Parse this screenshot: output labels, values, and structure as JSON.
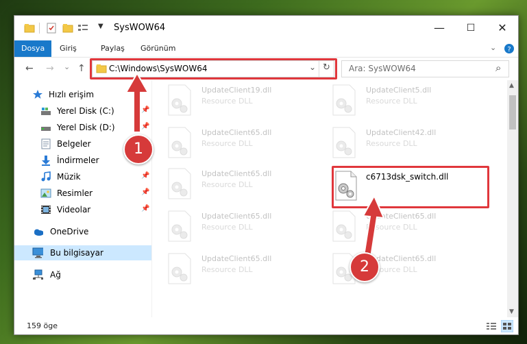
{
  "window": {
    "title": "SysWOW64",
    "controls": {
      "minimize": "—",
      "maximize": "☐",
      "close": "✕"
    }
  },
  "ribbon": {
    "tabs": [
      {
        "label": "Dosya",
        "active": true
      },
      {
        "label": "Giriş",
        "active": false
      },
      {
        "label": "Paylaş",
        "active": false
      },
      {
        "label": "Görünüm",
        "active": false
      }
    ],
    "expand_icon": "chevron-down-icon",
    "help_icon": "help-icon"
  },
  "navigation": {
    "back": "←",
    "forward": "→",
    "recent": "⌄",
    "up": "↑",
    "address": "C:\\Windows\\SysWOW64",
    "address_dropdown": "⌄",
    "refresh": "↻",
    "search_placeholder": "Ara: SysWOW64",
    "search_icon": "⌕"
  },
  "sidebar": {
    "items": [
      {
        "label": "Hızlı erişim",
        "icon": "star-icon",
        "pinned": false
      },
      {
        "label": "Yerel Disk (C:)",
        "icon": "drive-icon",
        "pinned": true
      },
      {
        "label": "Yerel Disk (D:)",
        "icon": "drive-icon",
        "pinned": true
      },
      {
        "label": "Belgeler",
        "icon": "document-icon",
        "pinned": true
      },
      {
        "label": "İndirmeler",
        "icon": "download-icon",
        "pinned": true
      },
      {
        "label": "Müzik",
        "icon": "music-icon",
        "pinned": true
      },
      {
        "label": "Resimler",
        "icon": "pictures-icon",
        "pinned": true
      },
      {
        "label": "Videolar",
        "icon": "video-icon",
        "pinned": true
      },
      {
        "label": "OneDrive",
        "icon": "cloud-icon",
        "pinned": false
      },
      {
        "label": "Bu bilgisayar",
        "icon": "computer-icon",
        "pinned": false,
        "selected": true
      },
      {
        "label": "Ağ",
        "icon": "network-icon",
        "pinned": false
      }
    ],
    "pin_glyph": "📌"
  },
  "files": [
    {
      "name": "UpdateClient19.dll",
      "desc": "Resource DLL"
    },
    {
      "name": "UpdateClient5.dll",
      "desc": "Resource DLL"
    },
    {
      "name": "UpdateClient65.dll",
      "desc": "Resource DLL"
    },
    {
      "name": "UpdateClient42.dll",
      "desc": "Resource DLL"
    },
    {
      "name": "UpdateClient65.dll",
      "desc": "Resource DLL"
    },
    {
      "name": "c6713dsk_switch.dll",
      "desc": ""
    },
    {
      "name": "UpdateClient65.dll",
      "desc": "Resource DLL"
    },
    {
      "name": "UpdateClient65.dll",
      "desc": "Resource DLL"
    },
    {
      "name": "UpdateClient65.dll",
      "desc": "Resource DLL"
    },
    {
      "name": "UpdateClient65.dll",
      "desc": "Resource DLL"
    }
  ],
  "status": {
    "item_count": "159 öge"
  },
  "annotations": {
    "step1": "1",
    "step2": "2",
    "highlight_color": "#e0373c"
  }
}
